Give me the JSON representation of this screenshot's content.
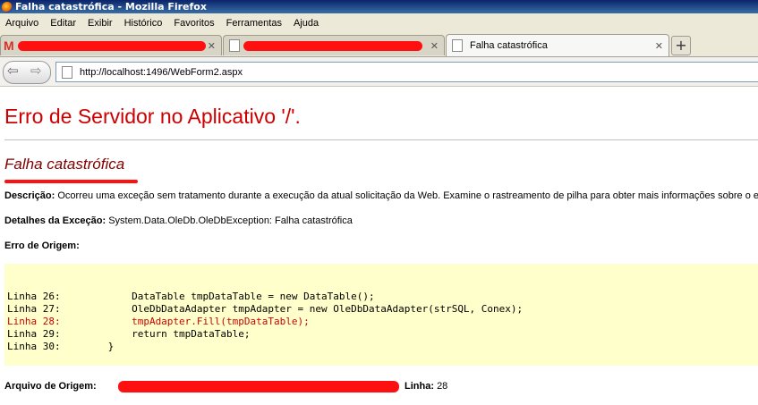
{
  "window": {
    "title": "Falha catastrófica - Mozilla Firefox"
  },
  "menu": [
    "Arquivo",
    "Editar",
    "Exibir",
    "Histórico",
    "Favoritos",
    "Ferramentas",
    "Ajuda"
  ],
  "tabs": [
    {
      "label": "",
      "icon": "gmail-icon",
      "redacted": true
    },
    {
      "label": "",
      "icon": "page-icon",
      "redacted": true
    },
    {
      "label": "Falha catastrófica",
      "icon": "page-icon",
      "active": true
    }
  ],
  "nav": {
    "url": "http://localhost:1496/WebForm2.aspx"
  },
  "page": {
    "heading": "Erro de Servidor no Aplicativo '/'.",
    "subheading": "Falha catastrófica",
    "description_label": "Descrição:",
    "description_text": "Ocorreu uma exceção sem tratamento durante a execução da atual solicitação da Web. Examine o rastreamento de pilha para obter mais informações sobre o e",
    "exception_label": "Detalhes da Exceção:",
    "exception_text": "System.Data.OleDb.OleDbException: Falha catastrófica",
    "source_error_label": "Erro de Origem:",
    "code_lines": [
      "Linha 26:            DataTable tmpDataTable = new DataTable();",
      "Linha 27:            OleDbDataAdapter tmpAdapter = new OleDbDataAdapter(strSQL, Conex);",
      "Linha 28:            tmpAdapter.Fill(tmpDataTable);",
      "Linha 29:            return tmpDataTable;",
      "Linha 30:        }"
    ],
    "source_file_label": "Arquivo de Origem:",
    "line_label": "Linha:",
    "line_value": "28"
  },
  "colors": {
    "error_red": "#cc0000",
    "title_maroon": "#800000",
    "code_bg": "#ffffcc",
    "redaction": "#ff1010"
  }
}
